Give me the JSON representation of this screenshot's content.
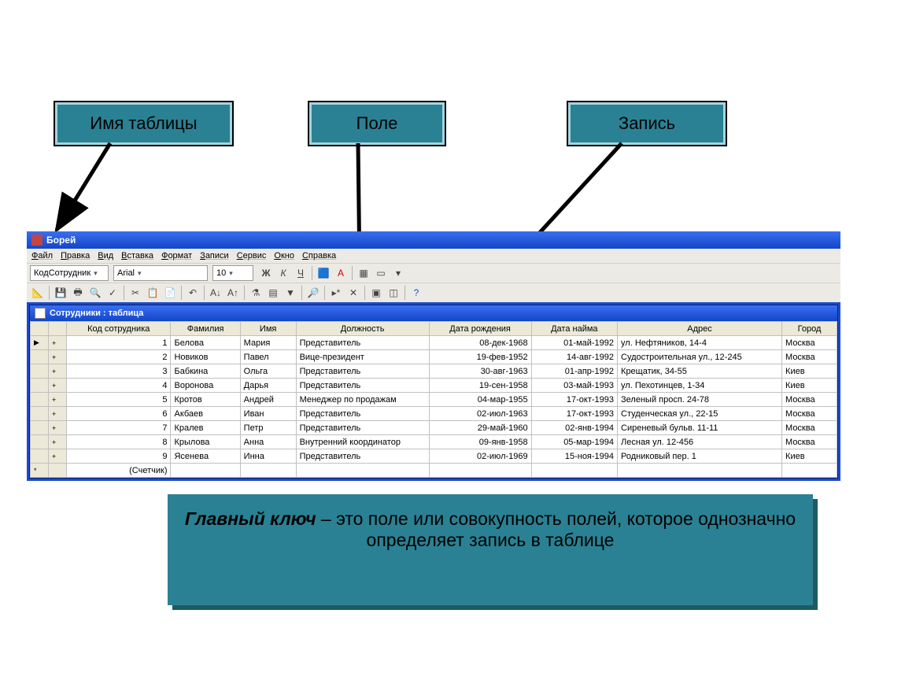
{
  "labels": {
    "table_name": "Имя таблицы",
    "field": "Поле",
    "record": "Запись"
  },
  "window": {
    "title": "Борей",
    "menu": [
      "Файл",
      "Правка",
      "Вид",
      "Вставка",
      "Формат",
      "Записи",
      "Сервис",
      "Окно",
      "Справка"
    ],
    "toolbar1": {
      "field_combo": "КодСотрудник",
      "font_combo": "Arial",
      "size_combo": "10"
    },
    "subtitle": "Сотрудники : таблица",
    "columns": [
      "Код сотрудника",
      "Фамилия",
      "Имя",
      "Должность",
      "Дата рождения",
      "Дата найма",
      "Адрес",
      "Город"
    ],
    "rows": [
      {
        "id": "1",
        "surname": "Белова",
        "name": "Мария",
        "position": "Представитель",
        "birth": "08-дек-1968",
        "hire": "01-май-1992",
        "address": "ул. Нефтяников, 14-4",
        "city": "Москва"
      },
      {
        "id": "2",
        "surname": "Новиков",
        "name": "Павел",
        "position": "Вице-президент",
        "birth": "19-фев-1952",
        "hire": "14-авг-1992",
        "address": "Судостроительная ул., 12-245",
        "city": "Москва"
      },
      {
        "id": "3",
        "surname": "Бабкина",
        "name": "Ольга",
        "position": "Представитель",
        "birth": "30-авг-1963",
        "hire": "01-апр-1992",
        "address": "Крещатик, 34-55",
        "city": "Киев"
      },
      {
        "id": "4",
        "surname": "Воронова",
        "name": "Дарья",
        "position": "Представитель",
        "birth": "19-сен-1958",
        "hire": "03-май-1993",
        "address": "ул. Пехотинцев, 1-34",
        "city": "Киев"
      },
      {
        "id": "5",
        "surname": "Кротов",
        "name": "Андрей",
        "position": "Менеджер по продажам",
        "birth": "04-мар-1955",
        "hire": "17-окт-1993",
        "address": "Зеленый просп. 24-78",
        "city": "Москва"
      },
      {
        "id": "6",
        "surname": "Акбаев",
        "name": "Иван",
        "position": "Представитель",
        "birth": "02-июл-1963",
        "hire": "17-окт-1993",
        "address": "Студенческая ул., 22-15",
        "city": "Москва"
      },
      {
        "id": "7",
        "surname": "Кралев",
        "name": "Петр",
        "position": "Представитель",
        "birth": "29-май-1960",
        "hire": "02-янв-1994",
        "address": "Сиреневый бульв. 11-11",
        "city": "Москва"
      },
      {
        "id": "8",
        "surname": "Крылова",
        "name": "Анна",
        "position": "Внутренний координатор",
        "birth": "09-янв-1958",
        "hire": "05-мар-1994",
        "address": "Лесная ул. 12-456",
        "city": "Москва"
      },
      {
        "id": "9",
        "surname": "Ясенева",
        "name": "Инна",
        "position": "Представитель",
        "birth": "02-июл-1969",
        "hire": "15-ноя-1994",
        "address": "Родниковый пер. 1",
        "city": "Киев"
      }
    ],
    "counter": "(Счетчик)"
  },
  "callout": {
    "bold": "Главный ключ",
    "rest": " – это поле или совокупность полей, которое  однозначно определяет запись в таблице"
  }
}
